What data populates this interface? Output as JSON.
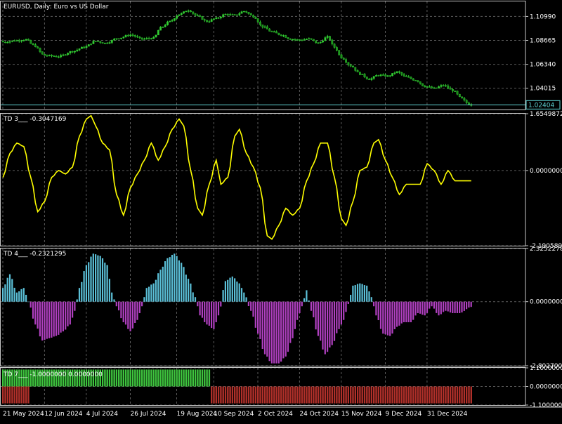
{
  "colors": {
    "background": "#000000",
    "grid": "#5a5a5a",
    "frame": "#c8c8c8",
    "text": "#ffffff",
    "candle_up": "#32cd32",
    "candle_down": "#1a8c1a",
    "price_line": "#5fd3d3",
    "price_label_bg": "#000000",
    "td3_line": "#ffff00",
    "td4_positive": "#5bc0d8",
    "td4_negative": "#b040c0",
    "td7_positive": "#3ec43e",
    "td7_negative": "#b0302a"
  },
  "panels": {
    "main": {
      "label": "EURUSD, Daily:  Euro vs US Dollar"
    },
    "td3": {
      "label": "TD 3___ -0.3047169"
    },
    "td4": {
      "label": "TD 4___ -0.2321295"
    },
    "td7": {
      "label": "TD 7___ -1.0000000 0.0000000"
    }
  },
  "chart_data": [
    {
      "type": "candlestick",
      "title": "EURUSD, Daily:  Euro vs US Dollar",
      "y_ticks": [
        "1.10990",
        "1.08665",
        "1.06340",
        "1.04015"
      ],
      "ylim": [
        1.0195,
        1.1245
      ],
      "current_price": "1.02404",
      "x_tick_labels": [
        "21 May 2024",
        "12 Jun 2024",
        "4 Jul 2024",
        "26 Jul 2024",
        "19 Aug 2024",
        "10 Sep 2024",
        "2 Oct 2024",
        "24 Oct 2024",
        "15 Nov 2024",
        "9 Dec 2024",
        "31 Dec 2024"
      ],
      "close_anchors": [
        [
          0,
          1.085
        ],
        [
          6,
          1.0865
        ],
        [
          10,
          1.0875
        ],
        [
          13,
          1.082
        ],
        [
          18,
          1.072
        ],
        [
          24,
          1.071
        ],
        [
          30,
          1.076
        ],
        [
          35,
          1.08
        ],
        [
          40,
          1.086
        ],
        [
          44,
          1.084
        ],
        [
          50,
          1.089
        ],
        [
          55,
          1.092
        ],
        [
          60,
          1.088
        ],
        [
          65,
          1.089
        ],
        [
          68,
          1.099
        ],
        [
          72,
          1.105
        ],
        [
          76,
          1.112
        ],
        [
          80,
          1.116
        ],
        [
          84,
          1.11
        ],
        [
          88,
          1.105
        ],
        [
          92,
          1.108
        ],
        [
          96,
          1.112
        ],
        [
          100,
          1.111
        ],
        [
          104,
          1.115
        ],
        [
          108,
          1.11
        ],
        [
          112,
          1.1
        ],
        [
          116,
          1.095
        ],
        [
          120,
          1.092
        ],
        [
          124,
          1.088
        ],
        [
          128,
          1.087
        ],
        [
          132,
          1.088
        ],
        [
          136,
          1.084
        ],
        [
          140,
          1.09
        ],
        [
          143,
          1.08
        ],
        [
          146,
          1.07
        ],
        [
          150,
          1.062
        ],
        [
          154,
          1.054
        ],
        [
          158,
          1.049
        ],
        [
          162,
          1.053
        ],
        [
          166,
          1.052
        ],
        [
          170,
          1.056
        ],
        [
          174,
          1.051
        ],
        [
          178,
          1.048
        ],
        [
          182,
          1.042
        ],
        [
          186,
          1.04
        ],
        [
          190,
          1.043
        ],
        [
          194,
          1.038
        ],
        [
          198,
          1.03
        ],
        [
          200,
          1.026
        ],
        [
          202,
          1.024
        ]
      ],
      "last_bar_index": 202
    },
    {
      "type": "line",
      "series": [
        {
          "name": "TD 3",
          "x_key": "bar_index"
        }
      ],
      "y_ticks": [
        "1.6549872",
        "0.0000000",
        "-2.1905890"
      ],
      "ylim": [
        -2.190589,
        1.6549872
      ],
      "last_value": -0.3047169,
      "anchors": [
        [
          0,
          -0.2
        ],
        [
          3,
          0.5
        ],
        [
          6,
          0.8
        ],
        [
          9,
          0.7
        ],
        [
          12,
          -0.2
        ],
        [
          15,
          -1.2
        ],
        [
          18,
          -0.9
        ],
        [
          21,
          -0.2
        ],
        [
          24,
          0.0
        ],
        [
          27,
          -0.1
        ],
        [
          30,
          0.1
        ],
        [
          33,
          1.0
        ],
        [
          36,
          1.5
        ],
        [
          38,
          1.6
        ],
        [
          40,
          1.3
        ],
        [
          43,
          0.8
        ],
        [
          46,
          0.6
        ],
        [
          49,
          -0.7
        ],
        [
          52,
          -1.3
        ],
        [
          55,
          -0.5
        ],
        [
          58,
          -0.1
        ],
        [
          61,
          0.3
        ],
        [
          64,
          0.8
        ],
        [
          67,
          0.3
        ],
        [
          70,
          0.7
        ],
        [
          73,
          1.2
        ],
        [
          76,
          1.5
        ],
        [
          78,
          1.3
        ],
        [
          81,
          0.0
        ],
        [
          84,
          -1.1
        ],
        [
          86,
          -1.3
        ],
        [
          89,
          -0.4
        ],
        [
          92,
          0.3
        ],
        [
          94,
          -0.4
        ],
        [
          97,
          -0.2
        ],
        [
          100,
          1.0
        ],
        [
          102,
          1.2
        ],
        [
          105,
          0.5
        ],
        [
          108,
          0.1
        ],
        [
          111,
          -0.5
        ],
        [
          114,
          -1.9
        ],
        [
          116,
          -2.0
        ],
        [
          119,
          -1.6
        ],
        [
          122,
          -1.1
        ],
        [
          125,
          -1.3
        ],
        [
          128,
          -1.1
        ],
        [
          131,
          -0.3
        ],
        [
          134,
          0.2
        ],
        [
          137,
          0.8
        ],
        [
          140,
          0.8
        ],
        [
          143,
          -0.2
        ],
        [
          146,
          -1.4
        ],
        [
          148,
          -1.6
        ],
        [
          151,
          -0.9
        ],
        [
          154,
          0.0
        ],
        [
          157,
          0.1
        ],
        [
          160,
          0.8
        ],
        [
          162,
          0.9
        ],
        [
          165,
          0.3
        ],
        [
          168,
          -0.2
        ],
        [
          171,
          -0.7
        ],
        [
          174,
          -0.4
        ],
        [
          177,
          -0.4
        ],
        [
          180,
          -0.4
        ],
        [
          183,
          0.2
        ],
        [
          186,
          0.0
        ],
        [
          189,
          -0.4
        ],
        [
          192,
          0.0
        ],
        [
          195,
          -0.3
        ],
        [
          198,
          -0.3
        ],
        [
          202,
          -0.3
        ]
      ]
    },
    {
      "type": "bar",
      "series": [
        {
          "name": "TD 4",
          "x_key": "bar_index"
        }
      ],
      "y_ticks": [
        "2.3252278",
        "0.0000000",
        "-2.8027008"
      ],
      "ylim": [
        -2.8027008,
        2.3252278
      ],
      "last_value": -0.2321295,
      "anchors": [
        [
          0,
          0.6
        ],
        [
          3,
          1.2
        ],
        [
          6,
          0.4
        ],
        [
          9,
          0.6
        ],
        [
          11,
          0.0
        ],
        [
          14,
          -1.0
        ],
        [
          17,
          -1.7
        ],
        [
          20,
          -1.6
        ],
        [
          23,
          -1.5
        ],
        [
          26,
          -1.3
        ],
        [
          29,
          -1.0
        ],
        [
          31,
          -0.4
        ],
        [
          33,
          0.6
        ],
        [
          36,
          1.6
        ],
        [
          39,
          2.1
        ],
        [
          42,
          2.0
        ],
        [
          45,
          1.6
        ],
        [
          47,
          0.4
        ],
        [
          49,
          -0.2
        ],
        [
          52,
          -0.9
        ],
        [
          55,
          -1.3
        ],
        [
          58,
          -0.8
        ],
        [
          60,
          -0.2
        ],
        [
          62,
          0.6
        ],
        [
          65,
          0.8
        ],
        [
          68,
          1.4
        ],
        [
          71,
          1.9
        ],
        [
          74,
          2.1
        ],
        [
          77,
          1.7
        ],
        [
          80,
          1.0
        ],
        [
          83,
          0.2
        ],
        [
          85,
          -0.6
        ],
        [
          88,
          -1.0
        ],
        [
          91,
          -1.2
        ],
        [
          93,
          -0.6
        ],
        [
          96,
          0.9
        ],
        [
          99,
          1.1
        ],
        [
          102,
          0.8
        ],
        [
          104,
          0.4
        ],
        [
          107,
          -0.4
        ],
        [
          110,
          -1.4
        ],
        [
          113,
          -2.3
        ],
        [
          116,
          -2.7
        ],
        [
          119,
          -2.7
        ],
        [
          122,
          -2.4
        ],
        [
          125,
          -1.6
        ],
        [
          127,
          -0.8
        ],
        [
          129,
          -0.2
        ],
        [
          131,
          0.5
        ],
        [
          133,
          -0.4
        ],
        [
          136,
          -1.5
        ],
        [
          139,
          -2.3
        ],
        [
          142,
          -1.9
        ],
        [
          145,
          -1.2
        ],
        [
          147,
          -0.8
        ],
        [
          149,
          -0.1
        ],
        [
          151,
          0.7
        ],
        [
          154,
          0.8
        ],
        [
          157,
          0.7
        ],
        [
          159,
          0.2
        ],
        [
          161,
          -0.6
        ],
        [
          164,
          -1.4
        ],
        [
          167,
          -1.5
        ],
        [
          170,
          -1.1
        ],
        [
          173,
          -0.9
        ],
        [
          176,
          -0.9
        ],
        [
          179,
          -0.5
        ],
        [
          182,
          -0.6
        ],
        [
          185,
          -0.2
        ],
        [
          188,
          -0.6
        ],
        [
          191,
          -0.4
        ],
        [
          194,
          -0.5
        ],
        [
          197,
          -0.5
        ],
        [
          202,
          -0.23
        ]
      ]
    },
    {
      "type": "bar",
      "series": [
        {
          "name": "TD 7",
          "x_key": "bar_index"
        }
      ],
      "y_ticks": [
        "1.1000000",
        "0.0000000",
        "-1.1000000"
      ],
      "ylim": [
        -1.1,
        1.1
      ],
      "segments": [
        {
          "from": 0,
          "to": 11,
          "value": 1
        },
        {
          "from": 0,
          "to": 11,
          "value": -1
        },
        {
          "from": 12,
          "to": 89,
          "value": 1
        },
        {
          "from": 90,
          "to": 202,
          "value": -1
        }
      ]
    }
  ]
}
